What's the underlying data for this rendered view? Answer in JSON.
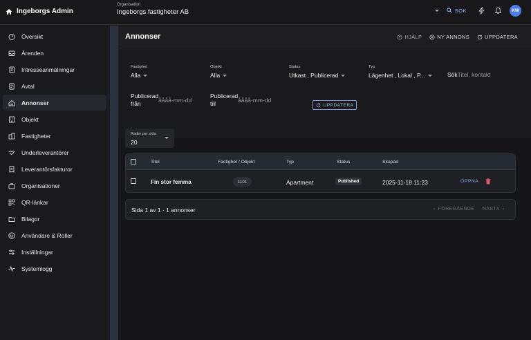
{
  "topbar": {
    "brand": "Ingeborgs Admin",
    "org_label": "Organisation",
    "org_name": "Ingeborgs fastigheter AB",
    "search_label": "SÖK",
    "avatar_initials": "KW"
  },
  "sidebar": {
    "items": [
      {
        "label": "Översikt",
        "icon": "dashboard-icon"
      },
      {
        "label": "Ärenden",
        "icon": "inbox-icon"
      },
      {
        "label": "Intresseanmälningar",
        "icon": "document-icon"
      },
      {
        "label": "Avtal",
        "icon": "contract-icon"
      },
      {
        "label": "Annonser",
        "icon": "home-icon",
        "active": true
      },
      {
        "label": "Objekt",
        "icon": "apartment-icon"
      },
      {
        "label": "Fastigheter",
        "icon": "building-icon"
      },
      {
        "label": "Underleverantörer",
        "icon": "handshake-icon"
      },
      {
        "label": "Leverantörsfakturor",
        "icon": "invoice-icon"
      },
      {
        "label": "Organisationer",
        "icon": "briefcase-icon"
      },
      {
        "label": "QR-länkar",
        "icon": "qr-code-icon"
      },
      {
        "label": "Bilagor",
        "icon": "folder-icon"
      },
      {
        "label": "Användare & Roller",
        "icon": "users-icon"
      },
      {
        "label": "Inställningar",
        "icon": "settings-icon"
      },
      {
        "label": "Systemlogg",
        "icon": "activity-icon"
      }
    ]
  },
  "page": {
    "title": "Annonser",
    "help_label": "HJÄLP",
    "new_label": "NY ANNONS",
    "refresh_label": "UPPDATERA"
  },
  "filters": {
    "property_label": "Fastighet",
    "property_value": "Alla",
    "object_label": "Objekt",
    "object_value": "Alla",
    "status_label": "Status",
    "status_value": "Utkast , Publicerad",
    "type_label": "Typ",
    "type_value": "Lägenhet , Lokal , P...",
    "search_label": "Sök",
    "search_placeholder": "Titel, kontakt",
    "published_from_label_1": "Publicerad",
    "published_from_label_2": "från",
    "published_from_placeholder": "åååå-mm-dd",
    "published_to_label_1": "Publicerad",
    "published_to_label_2": "till",
    "published_to_placeholder": "åååå-mm-dd",
    "update_button": "UPPDATERA"
  },
  "rows_per_page": {
    "label": "Rader per sida",
    "value": "20"
  },
  "table": {
    "headers": {
      "title": "Titel",
      "property_object": "Fastighet / Objekt",
      "type": "Typ",
      "status": "Status",
      "created": "Skapad"
    },
    "rows": [
      {
        "title": "Fin stor femma",
        "object": "1101",
        "type": "Apartment",
        "status": "Published",
        "created": "2025-11-18 11:23",
        "open_label": "ÖPPNA"
      }
    ]
  },
  "pagination": {
    "summary": "Sida 1 av 1 · 1 annonser",
    "prev_label": "FÖREGÅENDE",
    "next_label": "NÄSTA"
  },
  "colors": {
    "accent": "#4d7ee6",
    "danger": "#e05a6a"
  }
}
